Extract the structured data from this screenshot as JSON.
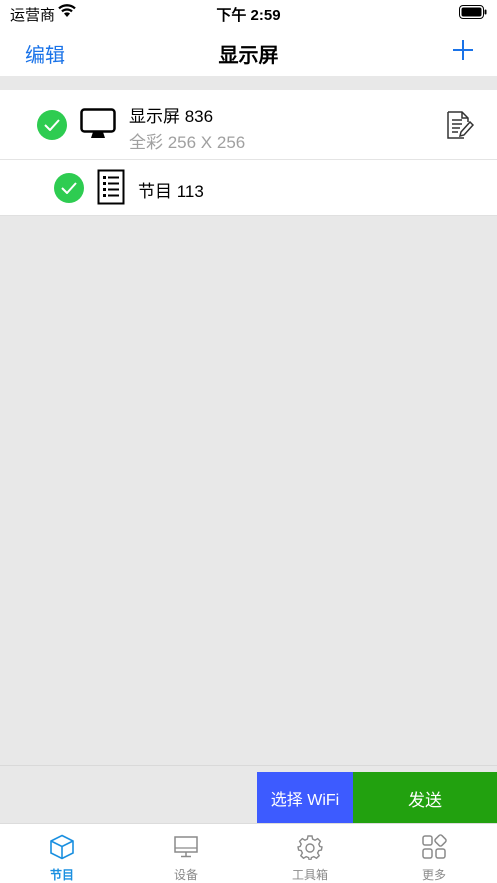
{
  "status_bar": {
    "carrier": "运营商",
    "time": "下午 2:59"
  },
  "nav": {
    "edit_label": "编辑",
    "title": "显示屏",
    "add_icon": "plus-icon"
  },
  "display": {
    "name": "显示屏 836",
    "spec": "全彩 256 X 256",
    "selected": true
  },
  "program": {
    "name": "节目 113",
    "selected": true
  },
  "actions": {
    "wifi_label": "选择 WiFi",
    "send_label": "发送",
    "wifi_color": "#3d5bff",
    "send_color": "#22a10f"
  },
  "tabs": [
    {
      "label": "节目",
      "icon": "box-icon",
      "active": true
    },
    {
      "label": "设备",
      "icon": "monitor-icon",
      "active": false
    },
    {
      "label": "工具箱",
      "icon": "gear-icon",
      "active": false
    },
    {
      "label": "更多",
      "icon": "grid-icon",
      "active": false
    }
  ],
  "colors": {
    "accent": "#1a73e8",
    "check_green": "#2ecc51",
    "active_tab": "#1a8fe0"
  }
}
